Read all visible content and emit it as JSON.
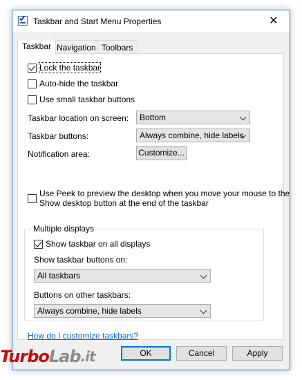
{
  "window": {
    "title": "Taskbar and Start Menu Properties",
    "close_glyph": "✕"
  },
  "tabs": [
    {
      "label": "Taskbar"
    },
    {
      "label": "Navigation"
    },
    {
      "label": "Toolbars"
    }
  ],
  "taskbar": {
    "lock": {
      "label": "Lock the taskbar",
      "checked": true
    },
    "autohide": {
      "label": "Auto-hide the taskbar",
      "checked": false
    },
    "small_buttons": {
      "label": "Use small taskbar buttons",
      "checked": false
    },
    "location_label": "Taskbar location on screen:",
    "location_value": "Bottom",
    "buttons_label": "Taskbar buttons:",
    "buttons_value": "Always combine, hide labels",
    "notification_label": "Notification area:",
    "customize_label": "Customize...",
    "peek_line1": "Use Peek to preview the desktop when you move your mouse to the",
    "peek_line2": "Show desktop button at the end of the taskbar",
    "peek_checked": false
  },
  "multiple_displays": {
    "title": "Multiple displays",
    "show_all": {
      "label": "Show taskbar on all displays",
      "checked": true
    },
    "show_on_label": "Show taskbar buttons on:",
    "show_on_value": "All taskbars",
    "other_label": "Buttons on other taskbars:",
    "other_value": "Always combine, hide labels"
  },
  "help_link": "How do I customize taskbars?",
  "footer": {
    "ok": "OK",
    "cancel": "Cancel",
    "apply": "Apply"
  },
  "watermark": {
    "part1": "Turbo",
    "part2": "Lab",
    "part3": ".it"
  }
}
